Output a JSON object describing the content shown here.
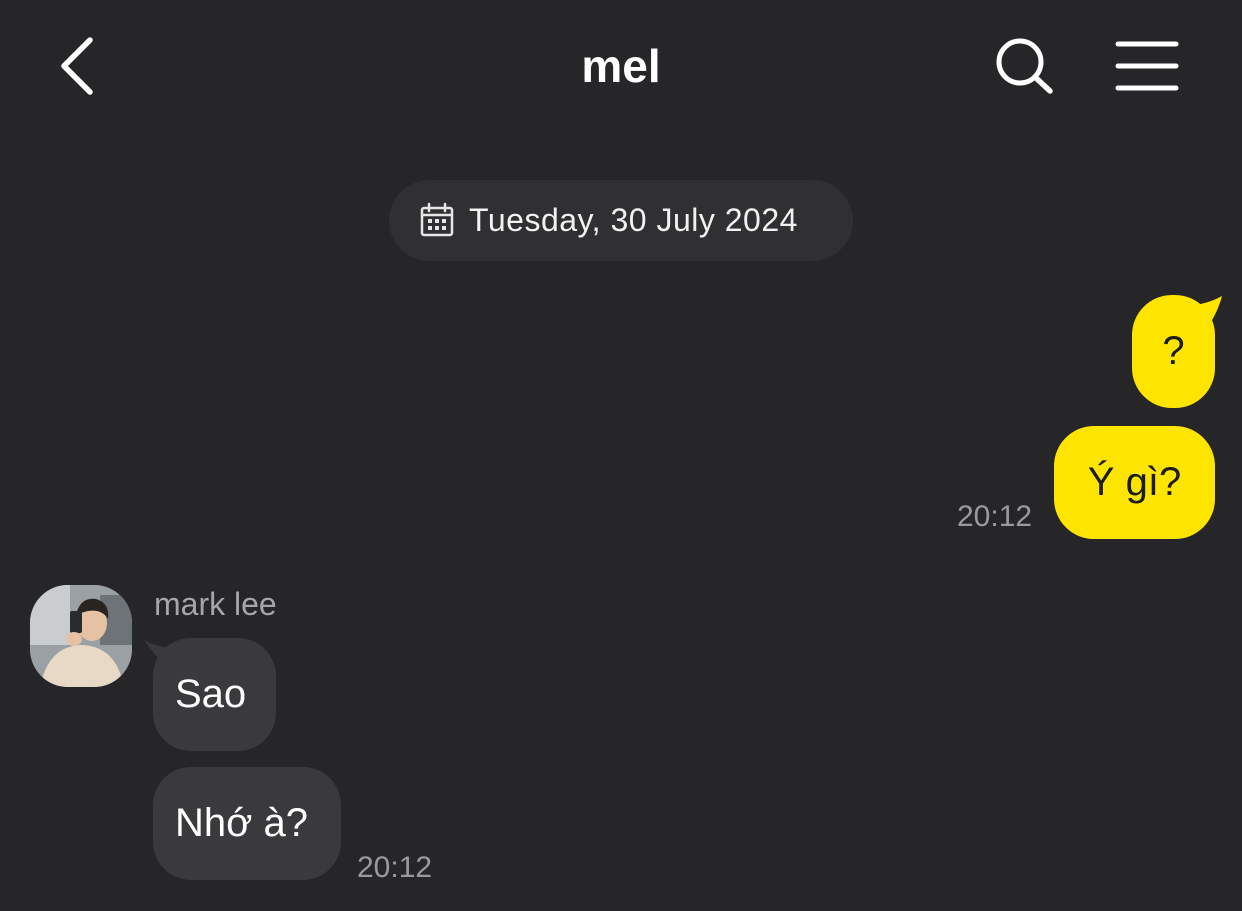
{
  "header": {
    "title": "mel",
    "back_icon": "chevron-left-icon",
    "search_icon": "search-icon",
    "menu_icon": "hamburger-menu-icon"
  },
  "date_separator": {
    "icon": "calendar-icon",
    "text": "Tuesday, 30 July 2024"
  },
  "messages_outgoing": [
    {
      "text": "?"
    },
    {
      "text": "Ý gì?",
      "time": "20:12"
    }
  ],
  "incoming": {
    "sender": "mark lee",
    "avatar": "profile-photo",
    "messages": [
      {
        "text": "Sao"
      },
      {
        "text": "Nhớ à?",
        "time": "20:12"
      }
    ]
  },
  "colors": {
    "background": "#262628",
    "outgoing_bubble": "#fee500",
    "incoming_bubble": "#3a3a3d",
    "date_pill": "#303033",
    "timestamp": "#9a9a9e"
  }
}
